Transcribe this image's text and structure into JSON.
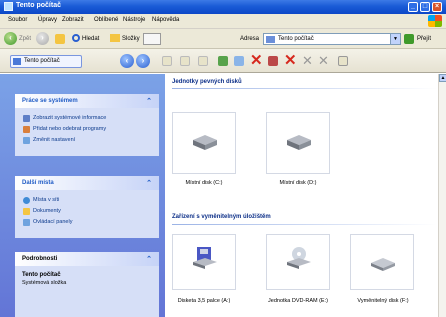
{
  "window": {
    "title": "Tento počítač"
  },
  "menu": [
    "Soubor",
    "Úpravy",
    "Zobrazit",
    "Oblíbené",
    "Nástroje",
    "Nápověda"
  ],
  "toolbar": {
    "back_label": "Zpět",
    "search_label": "Hledat",
    "folders_label": "Složky",
    "address_label": "Adresa",
    "address_value": "Tento počítač",
    "go_label": "Přejít"
  },
  "toolbar2": {
    "taskpane_label": "Tento počítač"
  },
  "left": {
    "system_tasks": {
      "title": "Práce se systémem",
      "items": [
        "Zobrazit systémové informace",
        "Přidat nebo odebrat programy",
        "Změnit nastavení"
      ]
    },
    "other_places": {
      "title": "Další místa",
      "items": [
        "Místa v síti",
        "Dokumenty",
        "Ovládací panely"
      ]
    },
    "details": {
      "title": "Podrobnosti",
      "name": "Tento počítač",
      "desc": "Systémová složka"
    }
  },
  "content": {
    "hdd_section": "Jednotky pevných disků",
    "hdd": [
      {
        "label": "Místní disk (C:)",
        "icon": "hard-drive-icon"
      },
      {
        "label": "Místní disk (D:)",
        "icon": "hard-drive-icon"
      }
    ],
    "removable_section": "Zařízení s vyměnitelným úložištěm",
    "removable": [
      {
        "label": "Disketa 3,5 palce (A:)",
        "icon": "floppy-drive-icon"
      },
      {
        "label": "Jednotka DVD-RAM (E:)",
        "icon": "dvd-drive-icon"
      },
      {
        "label": "Vyměnitelný disk (F:)",
        "icon": "removable-disk-icon"
      }
    ]
  }
}
